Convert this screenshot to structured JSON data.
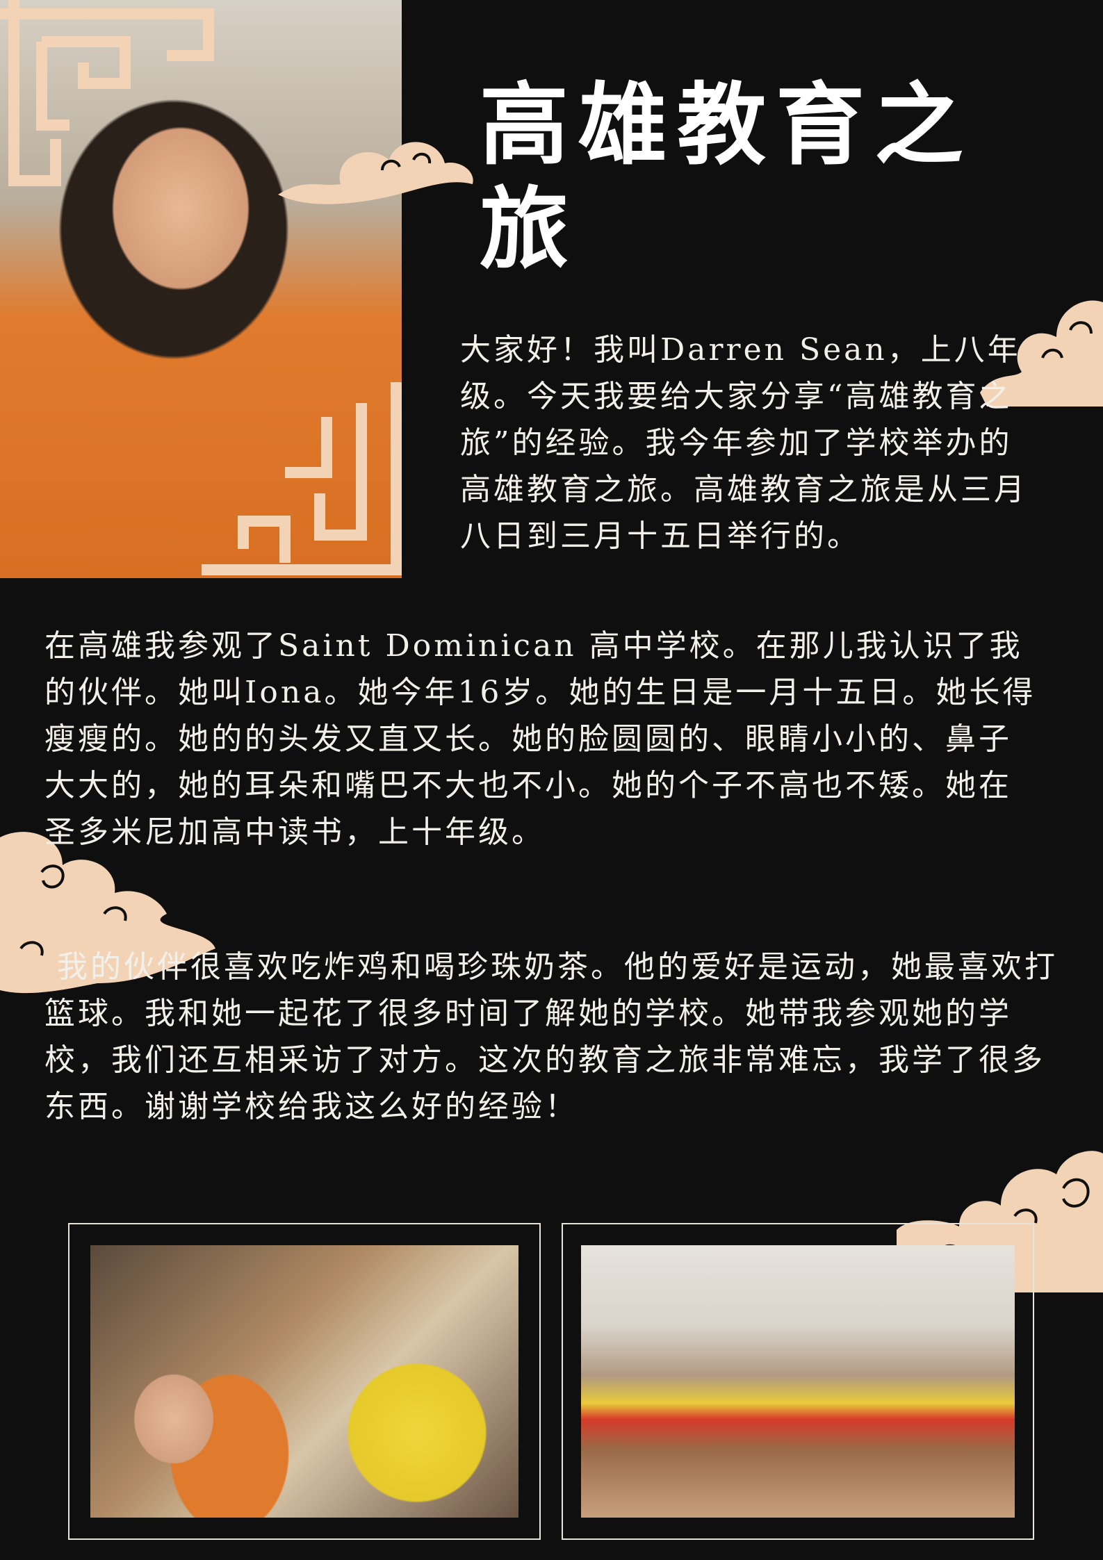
{
  "title": "高雄教育之旅",
  "intro": "大家好！我叫Darren Sean，上八年级。今天我要给大家分享“高雄教育之旅”的经验。我今年参加了学校举办的高雄教育之旅。高雄教育之旅是从三月八日到三月十五日举行的。",
  "paragraph_2": "在高雄我参观了Saint Dominican 高中学校。在那儿我认识了我的伙伴。她叫Iona。她今年16岁。她的生日是一月十五日。她长得瘦瘦的。她的的头发又直又长。她的脸圆圆的、眼睛小小的、鼻子大大的，她的耳朵和嘴巴不大也不小。她的个子不高也不矮。她在圣多米尼加高中读书，上十年级。",
  "paragraph_3": " 我的伙伴很喜欢吃炸鸡和喝珍珠奶茶。他的爱好是运动，她最喜欢打篮球。我和她一起花了很多时间了解她的学校。她带我参观她的学校，我们还互相采访了对方。这次的教育之旅非常难忘，我学了很多东西。谢谢学校给我这么好的经验！",
  "colors": {
    "background": "#0f0f0f",
    "accent": "#f3d3b5",
    "text": "#f3f0ea"
  },
  "decor": {
    "cloud": "cloud-ornament",
    "fret": "chinese-fret-border"
  }
}
